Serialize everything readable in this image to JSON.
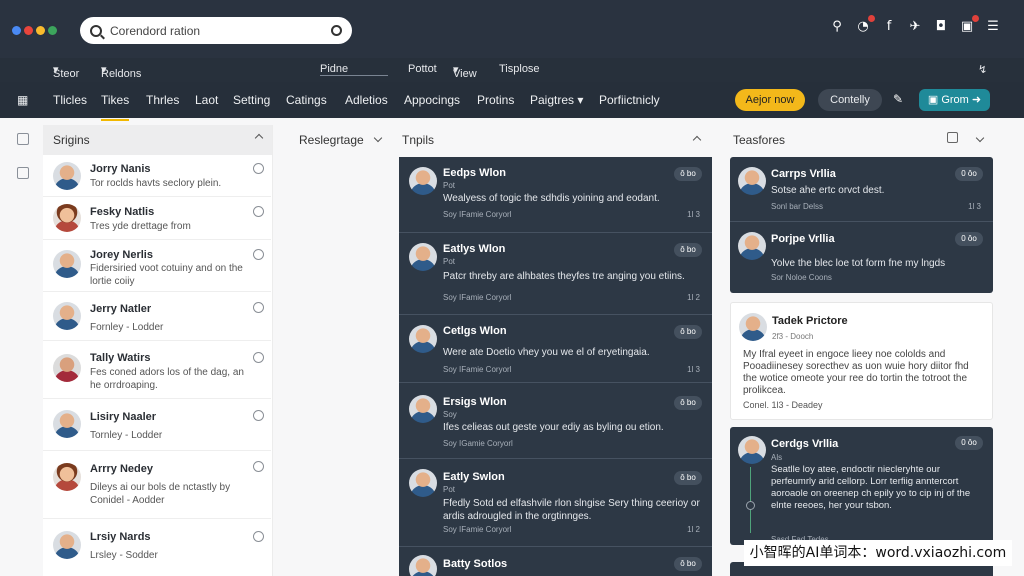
{
  "colors": {
    "topbar": "#2a3340",
    "accent_yellow": "#f3b81a",
    "accent_teal": "#1f8a99",
    "card_bg": "#2d3845"
  },
  "logo_dots": [
    "#4a8af4",
    "#e8453c",
    "#f9bb2d",
    "#3ca55c"
  ],
  "search": {
    "value": "Corendord ration",
    "icon": "search-icon"
  },
  "top_icons": [
    "search-icon",
    "notification-icon",
    "facebook-icon",
    "twitter-icon",
    "instagram-icon",
    "inbox-icon",
    "menu-icon"
  ],
  "subbar": {
    "item1": "Steor",
    "item2": "Reldons",
    "item3": "Pidne",
    "item4": "Pottot",
    "item5": "View",
    "item6": "Tisplose"
  },
  "tabs": [
    "Tlicles",
    "Tikes",
    "Thrles",
    "Laot",
    "Setting",
    "Catings",
    "Adletios",
    "Appocings",
    "Protins",
    "Paigtres",
    "Porfiictnicly"
  ],
  "actions": {
    "yellow": "Aejor now",
    "grey": "Contelly",
    "teal": "Grom"
  },
  "columns": {
    "col1": "Srigins",
    "col2": "Reslegrtage",
    "col3": "Tnpils",
    "col4": "Teasfores"
  },
  "people": [
    {
      "name": "Jorry Nanis",
      "sub": "Tor roclds havts seclory plein."
    },
    {
      "name": "Fesky Natlis",
      "sub": "Tres yde drettage from"
    },
    {
      "name": "Jorey Nerlis",
      "sub": "Fidersiried voot cotuiny and on the lortie coiiy"
    },
    {
      "name": "Jerry Natler",
      "sub": "Fornley - Lodder"
    },
    {
      "name": "Tally Watirs",
      "sub": "Fes coned adors los of the dag, an he orrdroaping."
    },
    {
      "name": "Lisiry Naaler",
      "sub": "Tornley - Lodder"
    },
    {
      "name": "Arrry Nedey",
      "sub": "Dileys ai our bols de nctastly by Conidel - Aodder"
    },
    {
      "name": "Lrsiy Nards",
      "sub": "Lrsley - Sodder"
    }
  ],
  "cards": [
    {
      "title": "Eedps Wlon",
      "sub": "Pot",
      "text": "Wealyess of togic the sdhdis yoining and eodant.",
      "foot": "Soy IFamie Coryorl",
      "num": "1l 3",
      "pill": "ô bo"
    },
    {
      "title": "Eatlys Wlon",
      "sub": "Pot",
      "text": "Patcr threby are alhbates theyfes tre anging you etiins.",
      "foot": "Soy IFamie Coryorl",
      "num": "1l 2",
      "pill": "ô bo"
    },
    {
      "title": "Cetlgs Wlon",
      "sub": "",
      "text": "Were ate Doetio vhey you we el of eryetingaia.",
      "foot": "Soy IFamie Coryorl",
      "num": "1l 3",
      "pill": "ô bo"
    },
    {
      "title": "Ersigs Wlon",
      "sub": "Soy",
      "text": "Ifes celieas out geste your ediy as byling ou etion.",
      "foot": "Soy IGamie Coryorl",
      "num": "",
      "pill": "ô bo"
    },
    {
      "title": "Eatly Swlon",
      "sub": "Pot",
      "text": "Ffedly Sotd ed elfashvile rlon slngise Sery thing ceerioy or ardis adrougled in the orgtinnges.",
      "foot": "Soy IFamie Coryorl",
      "num": "1l 2",
      "pill": "ô bo"
    },
    {
      "title": "Batty Sotlos",
      "sub": "",
      "text": "",
      "foot": "",
      "num": "",
      "pill": "ô bo"
    }
  ],
  "right_cards": [
    {
      "title": "Carrps Vrllia",
      "text": "Sotse ahe ertc orvct dest.",
      "foot": "Sonl bar Delss",
      "num": "1l 3",
      "pill": "0 ôo"
    },
    {
      "title": "Porjpe Vrllia",
      "text": "Yolve the blec loe tot form fne my lngds",
      "foot": "Sor Noloe Coons",
      "num": "1l 3",
      "pill": "0 ôo"
    }
  ],
  "light_card": {
    "title": "Tadek Prictore",
    "sub": "2f3 - Dooch",
    "text": "My Ifral eyeet in engoce lieey noe cololds and Pooadiinesey sorecthev as uon wuie hory diitor fhd the wotice omeote your ree do tortin the totroot the prolikcea.",
    "foot": "Conel. 1l3 - Deadey"
  },
  "bottom_card": {
    "title": "Cerdgs Vrllia",
    "sub": "Als",
    "text": "Seatlle loy atee, endoctir niecleryhte our perfeumrly arid cellorp. Lorr terfiig anntercort aoroaole on oreenep ch epily yo to cip inj of the elnte reeoes, her your tsbon.",
    "foot": "Sasd Fad Tedes",
    "pill": "0 ôo"
  },
  "watermark": "小智晖的AI单词本：word.vxiaozhi.com"
}
